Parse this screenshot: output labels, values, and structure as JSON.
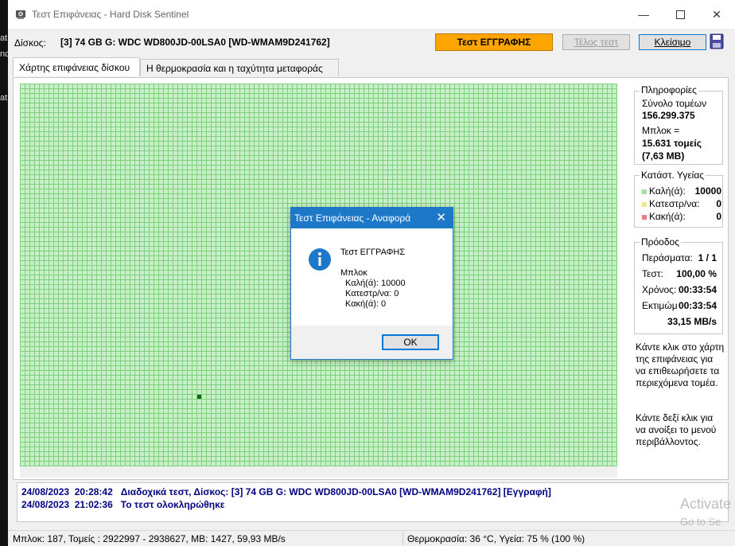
{
  "window": {
    "title": "Τεστ Επιφάνειας - Hard Disk Sentinel"
  },
  "desktop_fragments": [
    "at",
    "nc",
    "at"
  ],
  "toolbar": {
    "disk_label": "Δίσκος:",
    "disk_value": "[3] 74 GB G: WDC WD800JD-00LSA0 [WD-WMAM9D241762]",
    "test_button": "Τεστ ΕΓΓΡΑΦΗΣ",
    "end_test_button": "Τέλος τεστ",
    "close_button": "Κλείσιμο"
  },
  "tabs": [
    {
      "label": "Χάρτης επιφάνειας δίσκου"
    },
    {
      "label": "Η θερμοκρασία και η ταχύτητα μεταφοράς"
    }
  ],
  "info": {
    "title": "Πληροφορίες",
    "total_sectors_label": "Σύνολο τομέων",
    "total_sectors_value": "156.299.375",
    "block_label": "Μπλοκ =",
    "block_sectors": "15.631 τομείς",
    "block_size": "(7,63 MB)"
  },
  "health": {
    "title": "Κατάστ. Υγείας",
    "good_label": "Καλή(ά):",
    "good_value": "10000",
    "damaged_label": "Κατεστρ/να:",
    "damaged_value": "0",
    "bad_label": "Κακή(ά):",
    "bad_value": "0",
    "colors": {
      "good": "#9ee39e",
      "damaged": "#f0e68c",
      "bad": "#e88080"
    }
  },
  "progress": {
    "title": "Πρόοδος",
    "passes_label": "Περάσματα:",
    "passes_value": "1 / 1",
    "test_label": "Τεστ:",
    "test_value": "100,00 %",
    "time_label": "Χρόνος:",
    "time_value": "00:33:54",
    "estimated_label": "Εκτιμώμ",
    "estimated_value": "00:33:54",
    "speed_value": "33,15 MB/s"
  },
  "hints": {
    "left_click": "Κάντε κλικ στο χάρτη της επιφάνειας για να επιθεωρήσετε τα περιεχόμενα τομέα.",
    "right_click": "Κάντε δεξί κλικ για να ανοίξει το μενού περιβάλλοντος."
  },
  "log": [
    {
      "date": "24/08/2023",
      "time": "20:28:42",
      "text": "Διαδοχικά τεστ, Δίσκος: [3] 74 GB G: WDC WD800JD-00LSA0 [WD-WMAM9D241762] [Εγγραφή]"
    },
    {
      "date": "24/08/2023",
      "time": "21:02:36",
      "text": "Το τεστ ολοκληρώθηκε"
    }
  ],
  "status": {
    "left": "Μπλοκ: 187, Τομείς : 2922997 - 2938627, MB: 1427, 59,93 MB/s",
    "right": "Θερμοκρασία: 36  °C,  Υγεία: 75 % (100 %)"
  },
  "watermark": {
    "line1": "Activate",
    "line2": "Go to Se"
  },
  "dialog": {
    "title": "Τεστ Επιφάνειας - Αναφορά",
    "heading": "Τεστ ΕΓΓΡΑΦΗΣ",
    "block_label": "Μπλοκ",
    "good": "Καλή(ά): 10000",
    "damaged": "Κατεστρ/να: 0",
    "bad": "Κακή(ά): 0",
    "ok_label": "OK"
  },
  "colors": {
    "test_button": "#ffa500",
    "map_good": "#c8f0c8",
    "log_text": "#000080",
    "dialog_accent": "#1e78c8"
  }
}
